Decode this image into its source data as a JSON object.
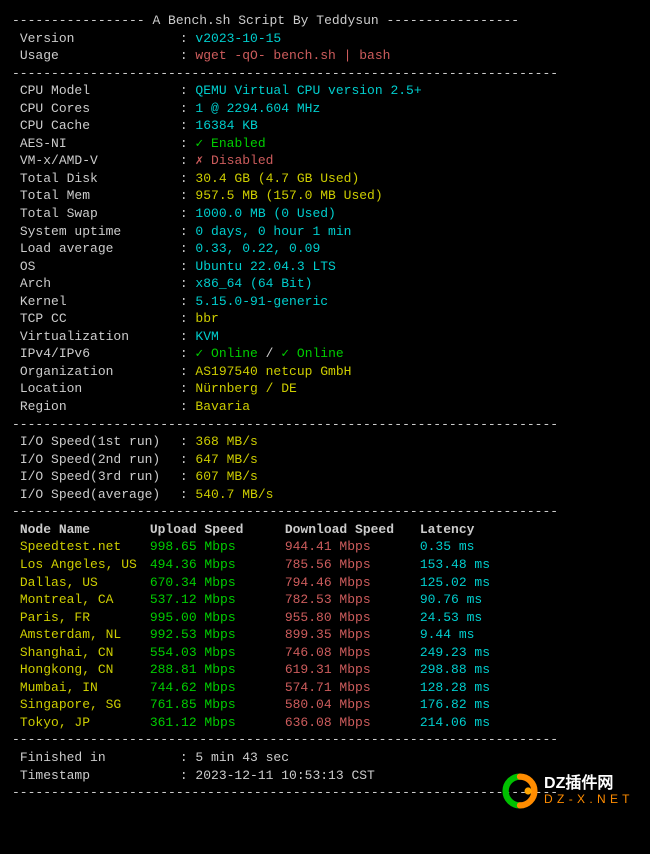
{
  "header_title": "A Bench.sh Script By Teddysun",
  "meta": {
    "version_label": "Version",
    "version_value": "v2023-10-15",
    "usage_label": "Usage",
    "usage_value": "wget -qO- bench.sh | bash"
  },
  "system": {
    "cpu_model_label": "CPU Model",
    "cpu_model_value": "QEMU Virtual CPU version 2.5+",
    "cpu_cores_label": "CPU Cores",
    "cpu_cores_value": "1 @ 2294.604 MHz",
    "cpu_cache_label": "CPU Cache",
    "cpu_cache_value": "16384 KB",
    "aesni_label": "AES-NI",
    "aesni_value": "✓ Enabled",
    "vmx_label": "VM-x/AMD-V",
    "vmx_value": "✗ Disabled",
    "disk_label": "Total Disk",
    "disk_value": "30.4 GB (4.7 GB Used)",
    "mem_label": "Total Mem",
    "mem_value": "957.5 MB (157.0 MB Used)",
    "swap_label": "Total Swap",
    "swap_value": "1000.0 MB (0 Used)",
    "uptime_label": "System uptime",
    "uptime_value": "0 days, 0 hour 1 min",
    "load_label": "Load average",
    "load_value": "0.33, 0.22, 0.09",
    "os_label": "OS",
    "os_value": "Ubuntu 22.04.3 LTS",
    "arch_label": "Arch",
    "arch_value": "x86_64 (64 Bit)",
    "kernel_label": "Kernel",
    "kernel_value": "5.15.0-91-generic",
    "tcpcc_label": "TCP CC",
    "tcpcc_value": "bbr",
    "virt_label": "Virtualization",
    "virt_value": "KVM",
    "ipv_label": "IPv4/IPv6",
    "ipv4_online": "✓ Online",
    "ipv_sep": " / ",
    "ipv6_online": "✓ Online",
    "org_label": "Organization",
    "org_value": "AS197540 netcup GmbH",
    "loc_label": "Location",
    "loc_value": "Nürnberg / DE",
    "region_label": "Region",
    "region_value": "Bavaria"
  },
  "io": {
    "run1_label": "I/O Speed(1st run)",
    "run1_value": "368 MB/s",
    "run2_label": "I/O Speed(2nd run)",
    "run2_value": "647 MB/s",
    "run3_label": "I/O Speed(3rd run)",
    "run3_value": "607 MB/s",
    "avg_label": "I/O Speed(average)",
    "avg_value": "540.7 MB/s"
  },
  "speedtest": {
    "head_node": "Node Name",
    "head_upload": "Upload Speed",
    "head_download": "Download Speed",
    "head_latency": "Latency",
    "rows": [
      {
        "node": "Speedtest.net",
        "up": "998.65 Mbps",
        "down": "944.41 Mbps",
        "lat": "0.35 ms"
      },
      {
        "node": "Los Angeles, US",
        "up": "494.36 Mbps",
        "down": "785.56 Mbps",
        "lat": "153.48 ms"
      },
      {
        "node": "Dallas, US",
        "up": "670.34 Mbps",
        "down": "794.46 Mbps",
        "lat": "125.02 ms"
      },
      {
        "node": "Montreal, CA",
        "up": "537.12 Mbps",
        "down": "782.53 Mbps",
        "lat": "90.76 ms"
      },
      {
        "node": "Paris, FR",
        "up": "995.00 Mbps",
        "down": "955.80 Mbps",
        "lat": "24.53 ms"
      },
      {
        "node": "Amsterdam, NL",
        "up": "992.53 Mbps",
        "down": "899.35 Mbps",
        "lat": "9.44 ms"
      },
      {
        "node": "Shanghai, CN",
        "up": "554.03 Mbps",
        "down": "746.08 Mbps",
        "lat": "249.23 ms"
      },
      {
        "node": "Hongkong, CN",
        "up": "288.81 Mbps",
        "down": "619.31 Mbps",
        "lat": "298.88 ms"
      },
      {
        "node": "Mumbai, IN",
        "up": "744.62 Mbps",
        "down": "574.71 Mbps",
        "lat": "128.28 ms"
      },
      {
        "node": "Singapore, SG",
        "up": "761.85 Mbps",
        "down": "580.04 Mbps",
        "lat": "176.82 ms"
      },
      {
        "node": "Tokyo, JP",
        "up": "361.12 Mbps",
        "down": "636.08 Mbps",
        "lat": "214.06 ms"
      }
    ]
  },
  "footer": {
    "finished_label": "Finished in",
    "finished_value": "5 min 43 sec",
    "timestamp_label": "Timestamp",
    "timestamp_value": "2023-12-11 10:53:13 CST"
  },
  "watermark": {
    "line1": "DZ插件网",
    "line2": "D Z - X . N E T"
  },
  "dashes": {
    "title_open": "----------------- ",
    "title_close": " -----------------",
    "full": "----------------------------------------------------------------------"
  }
}
